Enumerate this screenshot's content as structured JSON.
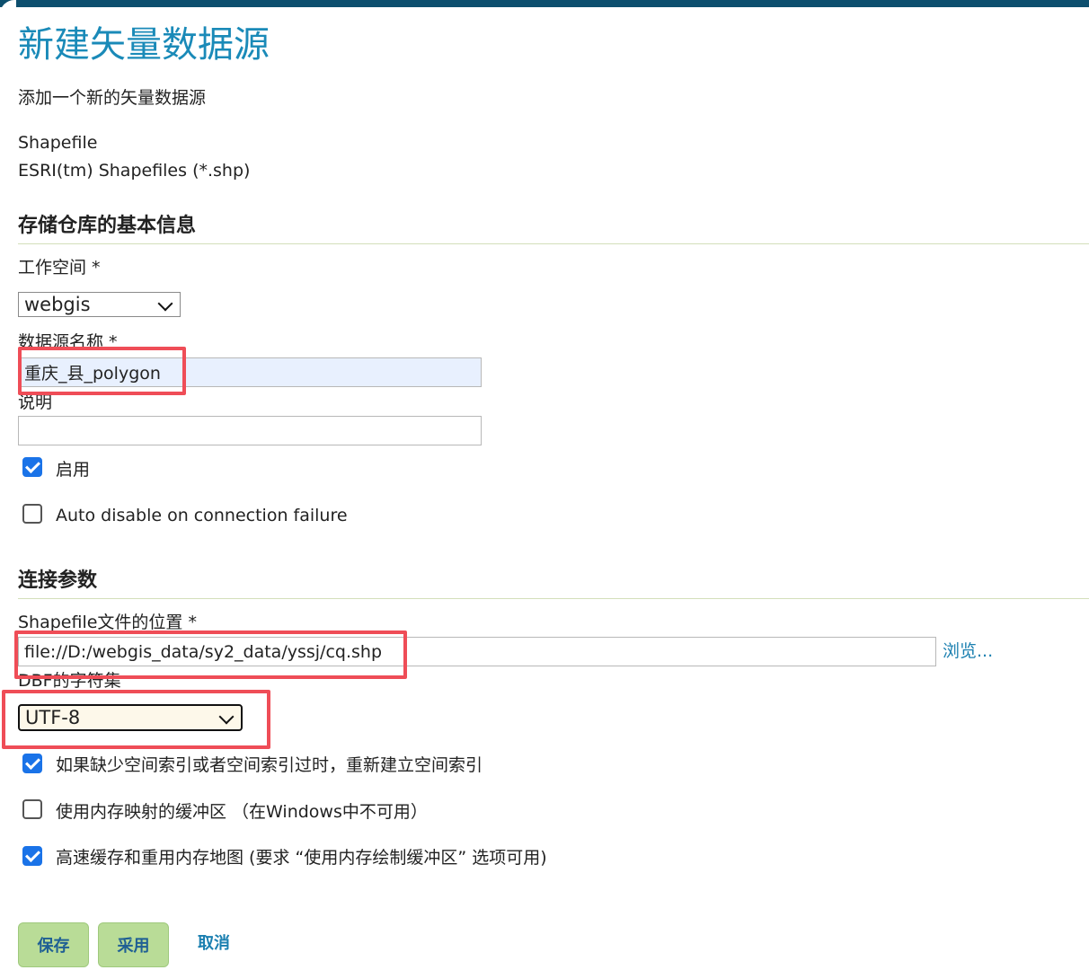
{
  "page": {
    "title": "新建矢量数据源",
    "subtitle": "添加一个新的矢量数据源"
  },
  "store": {
    "type": "Shapefile",
    "description": "ESRI(tm) Shapefiles (*.shp)"
  },
  "basic_info": {
    "heading": "存储仓库的基本信息",
    "workspace_label": "工作空间 *",
    "workspace_value": "webgis",
    "name_label": "数据源名称 *",
    "name_value": "重庆_县_polygon",
    "description_label": "说明",
    "description_value": "",
    "enabled_label": "启用",
    "enabled_checked": true,
    "auto_disable_label": "Auto disable on connection failure",
    "auto_disable_checked": false
  },
  "connection": {
    "heading": "连接参数",
    "location_label": "Shapefile文件的位置 *",
    "location_value": "file://D:/webgis_data/sy2_data/yssj/cq.shp",
    "browse_label": "浏览...",
    "charset_label": "DBF的字符集",
    "charset_value": "UTF-8",
    "options": [
      {
        "label": "如果缺少空间索引或者空间索引过时，重新建立空间索引",
        "checked": true
      },
      {
        "label": "使用内存映射的缓冲区 （在Windows中不可用）",
        "checked": false
      },
      {
        "label": "高速缓存和重用内存地图 (要求 “使用内存绘制缓冲区” 选项可用)",
        "checked": true
      }
    ]
  },
  "actions": {
    "save": "保存",
    "apply": "采用",
    "cancel": "取消"
  },
  "colors": {
    "title": "#1a8ab8",
    "highlight": "#ef4d57",
    "button": "#b9dc97",
    "checkbox": "#1a73e8"
  }
}
